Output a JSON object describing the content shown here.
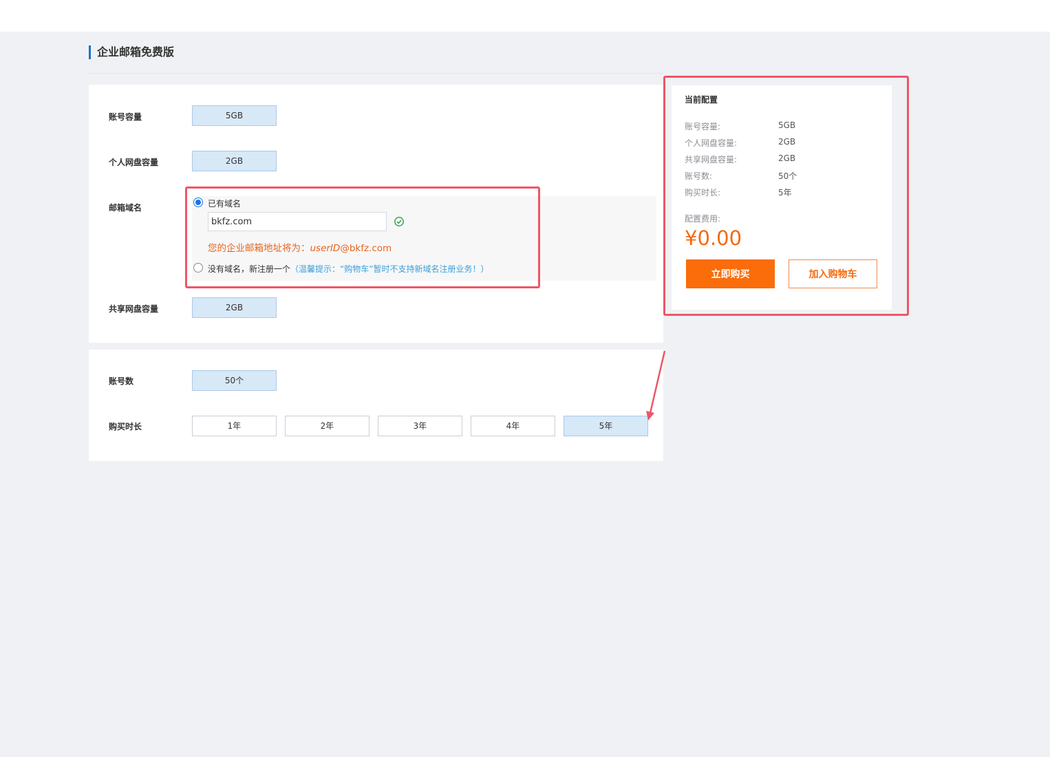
{
  "page": {
    "title": "企业邮箱免费版"
  },
  "form": {
    "capacity": {
      "label": "账号容量",
      "value": "5GB"
    },
    "netdisk": {
      "label": "个人网盘容量",
      "value": "2GB"
    },
    "domain": {
      "label": "邮箱域名",
      "option_existing": "已有域名",
      "input_value": "bkfz.com",
      "address_prefix": "您的企业邮箱地址将为：",
      "address_user": "userID",
      "address_suffix": "@bkfz.com",
      "option_register": "没有域名，新注册一个",
      "tip": "（温馨提示：“购物车”暂时不支持新域名注册业务！）"
    },
    "shared": {
      "label": "共享网盘容量",
      "value": "2GB"
    },
    "accounts": {
      "label": "账号数",
      "value": "50个"
    },
    "duration": {
      "label": "购买时长",
      "options": [
        "1年",
        "2年",
        "3年",
        "4年",
        "5年"
      ],
      "selected": "5年"
    }
  },
  "summary": {
    "title": "当前配置",
    "items": [
      {
        "key": "账号容量:",
        "value": "5GB"
      },
      {
        "key": "个人网盘容量:",
        "value": "2GB"
      },
      {
        "key": "共享网盘容量:",
        "value": "2GB"
      },
      {
        "key": "账号数:",
        "value": "50个"
      },
      {
        "key": "购买时长:",
        "value": "5年"
      }
    ],
    "fee_label": "配置费用:",
    "price": "¥0.00",
    "buy_label": "立即购买",
    "cart_label": "加入购物车"
  },
  "colors": {
    "accent": "#fa6d0a",
    "highlight": "#ee5668",
    "selected": "#d7e8f7",
    "link": "#3ba0d8"
  }
}
